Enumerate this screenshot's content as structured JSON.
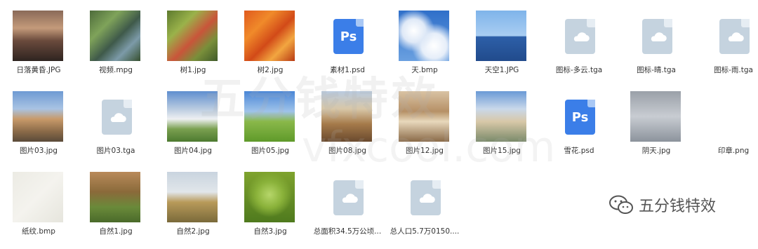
{
  "files": {
    "row1": [
      {
        "name": "日落黄昏.JPG",
        "type": "image",
        "palette": "sunset"
      },
      {
        "name": "视频.mpg",
        "type": "image",
        "palette": "stream"
      },
      {
        "name": "树1.jpg",
        "type": "image",
        "palette": "tree1"
      },
      {
        "name": "树2.jpg",
        "type": "image",
        "palette": "tree2"
      },
      {
        "name": "素材1.psd",
        "type": "psd",
        "icon_text": "Ps"
      },
      {
        "name": "天.bmp",
        "type": "image",
        "palette": "sky"
      },
      {
        "name": "天空1.JPG",
        "type": "image",
        "palette": "sea"
      },
      {
        "name": "图标-多云.tga",
        "type": "doc"
      },
      {
        "name": "图标-晴.tga",
        "type": "doc"
      },
      {
        "name": "图标-雨.tga",
        "type": "doc"
      }
    ],
    "row2": [
      {
        "name": "图片03.jpg",
        "type": "image",
        "palette": "castle"
      },
      {
        "name": "图片03.tga",
        "type": "doc"
      },
      {
        "name": "图片04.jpg",
        "type": "image",
        "palette": "church"
      },
      {
        "name": "图片05.jpg",
        "type": "image",
        "palette": "meadow"
      },
      {
        "name": "图片08.jpg",
        "type": "image",
        "palette": "parliament"
      },
      {
        "name": "图片12.jpg",
        "type": "image",
        "palette": "hall"
      },
      {
        "name": "图片15.jpg",
        "type": "image",
        "palette": "coast"
      },
      {
        "name": "雪花.psd",
        "type": "psd",
        "icon_text": "Ps"
      },
      {
        "name": "阴天.jpg",
        "type": "image",
        "palette": "cloudy"
      },
      {
        "name": "印章.png",
        "type": "blank"
      }
    ],
    "row3": [
      {
        "name": "纸纹.bmp",
        "type": "image",
        "palette": "paper"
      },
      {
        "name": "自然1.jpg",
        "type": "image",
        "palette": "forest"
      },
      {
        "name": "自然2.jpg",
        "type": "image",
        "palette": "hill"
      },
      {
        "name": "自然3.jpg",
        "type": "image",
        "palette": "leaf"
      },
      {
        "name": "总面积34.5万公顷...",
        "type": "doc"
      },
      {
        "name": "总人口5.7万0150....",
        "type": "doc"
      }
    ]
  },
  "watermark": {
    "text": "五分钱特效",
    "url": "vfxcool.com"
  },
  "brand": {
    "label": "五分钱特效",
    "icon": "wechat-icon"
  },
  "colors": {
    "ps_blue": "#3b7ee8",
    "doc_gray": "#c5d3df",
    "label": "#333333"
  }
}
